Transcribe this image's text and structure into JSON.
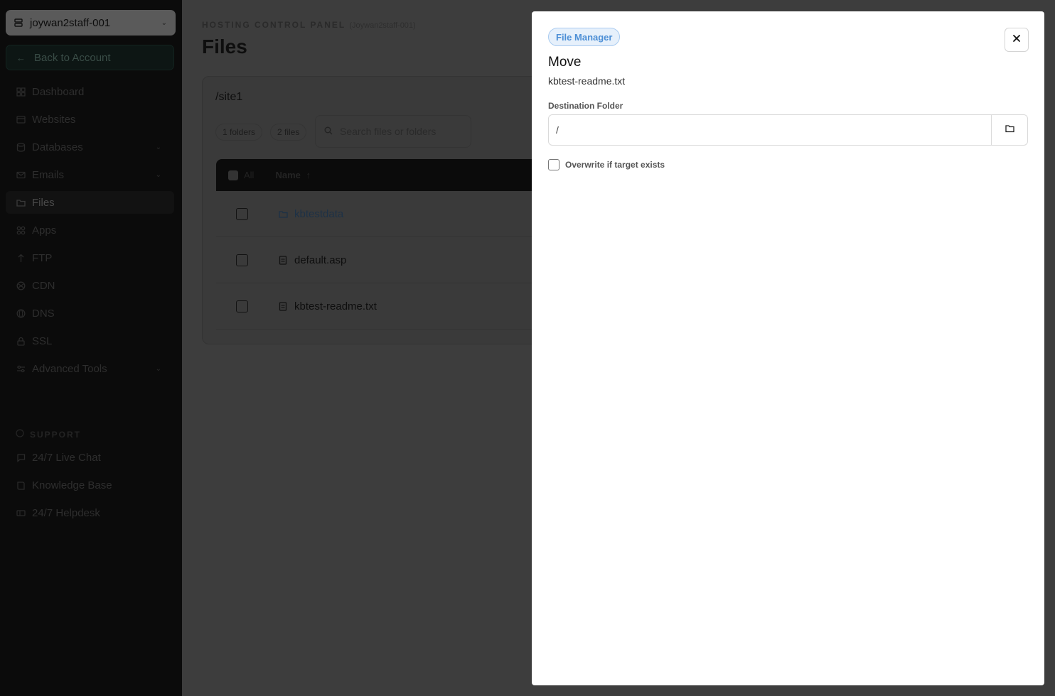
{
  "sidebar": {
    "account_name": "joywan2staff-001",
    "back_label": "Back to Account",
    "items": [
      {
        "label": "Dashboard",
        "icon": "grid-icon"
      },
      {
        "label": "Websites",
        "icon": "browser-icon"
      },
      {
        "label": "Databases",
        "icon": "database-icon",
        "expandable": true
      },
      {
        "label": "Emails",
        "icon": "mail-icon",
        "expandable": true
      },
      {
        "label": "Files",
        "icon": "folder-icon",
        "active": true
      },
      {
        "label": "Apps",
        "icon": "apps-icon"
      },
      {
        "label": "FTP",
        "icon": "ftp-icon"
      },
      {
        "label": "CDN",
        "icon": "cdn-icon"
      },
      {
        "label": "DNS",
        "icon": "globe-icon"
      },
      {
        "label": "SSL",
        "icon": "lock-icon"
      },
      {
        "label": "Advanced Tools",
        "icon": "sliders-icon",
        "expandable": true
      }
    ],
    "support_label": "SUPPORT",
    "support_items": [
      {
        "label": "24/7 Live Chat",
        "icon": "chat-icon"
      },
      {
        "label": "Knowledge Base",
        "icon": "book-icon"
      },
      {
        "label": "24/7 Helpdesk",
        "icon": "ticket-icon"
      }
    ]
  },
  "main": {
    "kicker": "HOSTING CONTROL PANEL",
    "kicker_account": "(Joywan2staff-001)",
    "title": "Files",
    "path": "/site1",
    "folder_count": "1 folders",
    "file_count": "2 files",
    "search_placeholder": "Search files or folders",
    "table": {
      "select_all_label": "All",
      "name_header": "Name",
      "sort_indicator": "↑",
      "rows": [
        {
          "name": "kbtestdata",
          "type": "folder"
        },
        {
          "name": "default.asp",
          "type": "file"
        },
        {
          "name": "kbtest-readme.txt",
          "type": "file"
        }
      ]
    }
  },
  "modal": {
    "badge": "File Manager",
    "title": "Move",
    "subtitle": "kbtest-readme.txt",
    "destination_label": "Destination Folder",
    "destination_value": "/",
    "overwrite_label": "Overwrite if target exists",
    "overwrite_checked": false
  }
}
